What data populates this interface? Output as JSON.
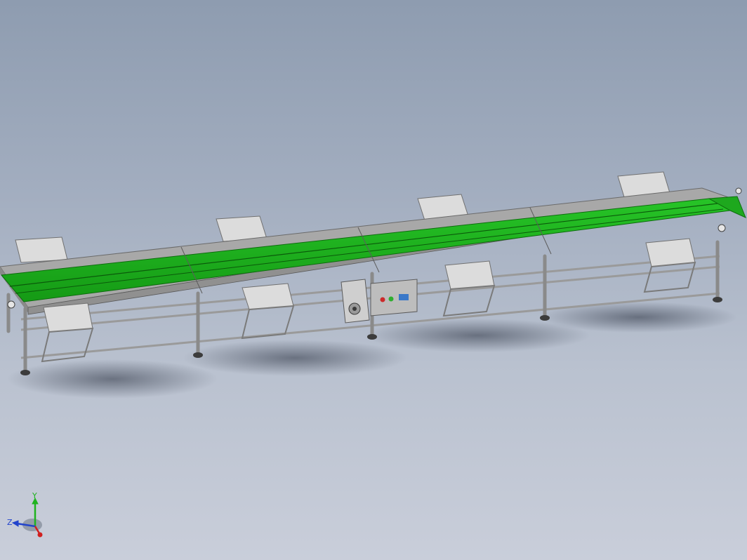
{
  "viewport": {
    "background_top": "#8e9cb0",
    "background_bottom": "#c9ceda"
  },
  "model": {
    "belt_color": "#1fb31f",
    "frame_color": "#a8a8a8",
    "tray_color": "#dcdcdc",
    "leg_color": "#8a8a8a"
  },
  "control_box": {
    "color": "#bdbdbd",
    "indicator_colors": [
      "#cc2a2a",
      "#2fae2f"
    ],
    "display_color": "#3a78c8"
  },
  "triad": {
    "y_label": "Y",
    "z_label": "Z",
    "y_color": "#1fb31f",
    "z_color": "#2244cc",
    "x_color": "#d02020"
  }
}
